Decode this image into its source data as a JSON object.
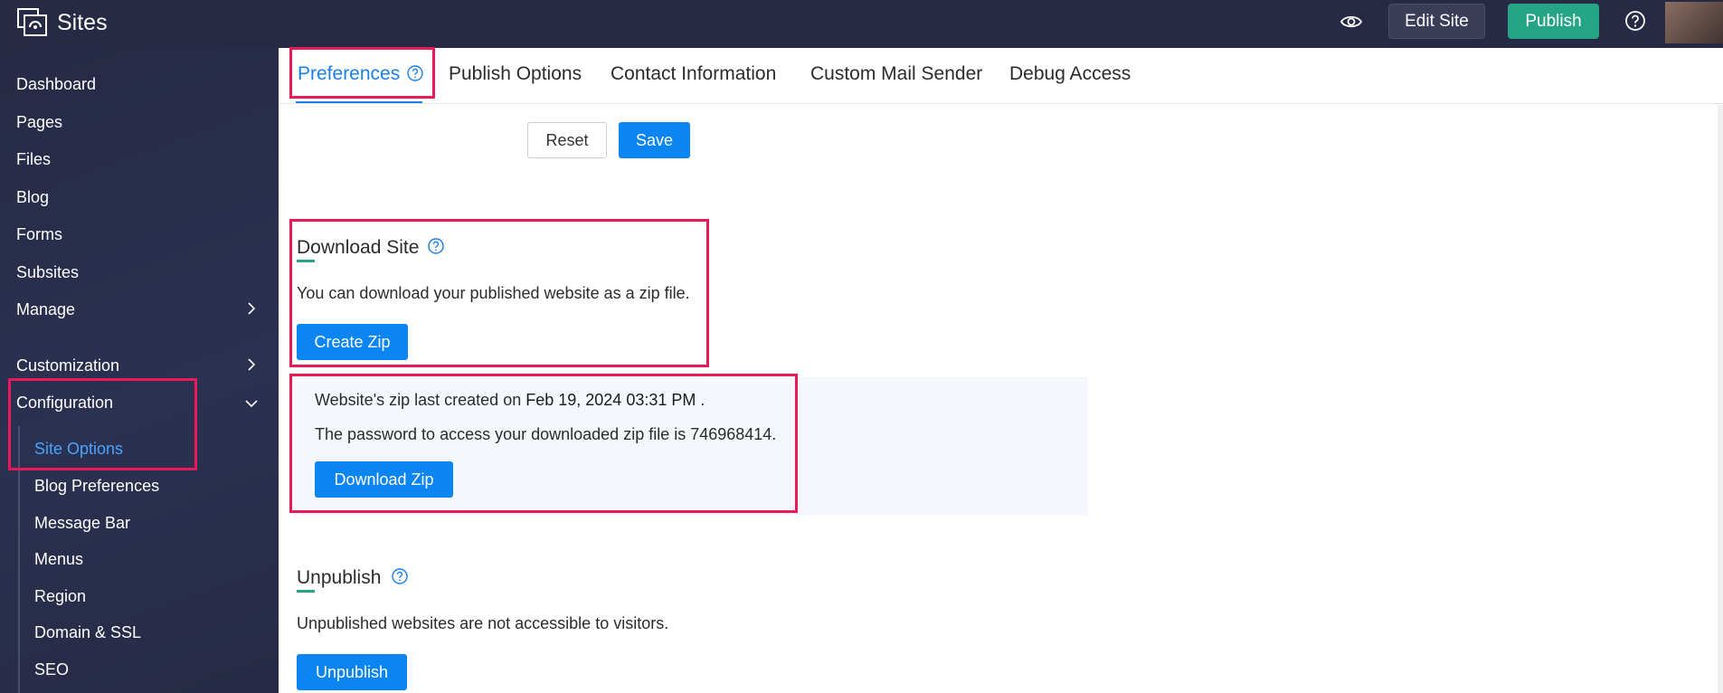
{
  "app": {
    "title": "Sites"
  },
  "topbar": {
    "preview_icon": "eye-icon",
    "edit_site_label": "Edit Site",
    "publish_label": "Publish",
    "help_icon": "help-circle-icon"
  },
  "sidebar": {
    "items": [
      {
        "label": "Dashboard"
      },
      {
        "label": "Pages"
      },
      {
        "label": "Files"
      },
      {
        "label": "Blog"
      },
      {
        "label": "Forms"
      },
      {
        "label": "Subsites"
      },
      {
        "label": "Manage",
        "expandable": true
      },
      {
        "label": "Customization",
        "expandable": true
      },
      {
        "label": "Configuration",
        "expanded": true
      }
    ],
    "configuration_items": [
      {
        "label": "Site Options",
        "active": true
      },
      {
        "label": "Blog Preferences"
      },
      {
        "label": "Message Bar"
      },
      {
        "label": "Menus"
      },
      {
        "label": "Region"
      },
      {
        "label": "Domain & SSL"
      },
      {
        "label": "SEO"
      }
    ]
  },
  "tabs": [
    {
      "label": "Preferences",
      "active": true
    },
    {
      "label": "Publish Options"
    },
    {
      "label": "Contact Information"
    },
    {
      "label": "Custom Mail Sender"
    },
    {
      "label": "Debug Access"
    }
  ],
  "form_actions": {
    "reset_label": "Reset",
    "save_label": "Save"
  },
  "download_site": {
    "title": "Download Site",
    "description": "You can download your published website as a zip file.",
    "create_zip_label": "Create Zip",
    "last_created_prefix": "Website's zip last created on",
    "last_created_date": "Feb 19, 2024 03:31 PM",
    "last_created_suffix": ".",
    "password_text": "The password to access your downloaded zip file is 746968414.",
    "download_zip_label": "Download Zip"
  },
  "unpublish": {
    "title": "Unpublish",
    "description": "Unpublished websites are not accessible to visitors.",
    "button_label": "Unpublish"
  },
  "colors": {
    "topbar_bg": "#262a45",
    "accent_blue": "#0a85f2",
    "publish_green": "#26a586",
    "highlight": "#ea1a5a"
  }
}
